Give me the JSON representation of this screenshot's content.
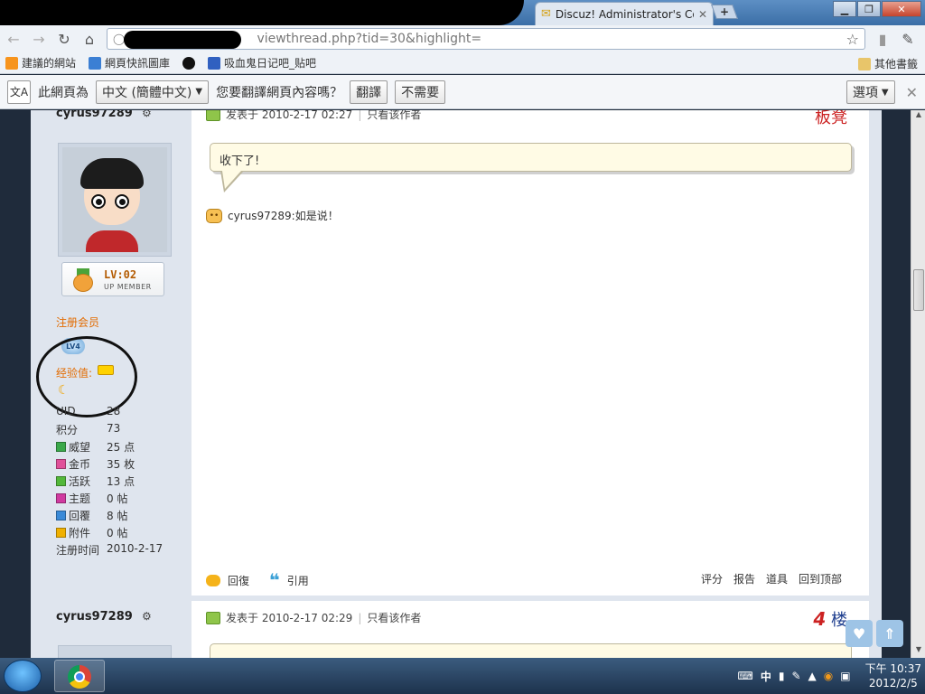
{
  "browser": {
    "tab_title": "Discuz! Administrator's Co",
    "url": "viewthread.php?tid=30&highlight=",
    "bookmarks": [
      {
        "label": "建議的網站",
        "color": "#f7941d"
      },
      {
        "label": "網頁快訊圖庫",
        "color": "#3b7fd4"
      },
      {
        "label": "",
        "color": "#c92a2a"
      },
      {
        "label": "吸血鬼日记吧_贴吧",
        "color": "#3060c0"
      }
    ],
    "bookmarks_other": "其他書籤",
    "translate": {
      "prompt_prefix": "此網頁為",
      "language": "中文 (簡體中文)",
      "question": "您要翻譯網頁內容嗎？",
      "translate_btn": "翻譯",
      "no_btn": "不需要",
      "options_btn": "選項"
    }
  },
  "user": {
    "name": "cyrus97289",
    "badge_level": "LV:02",
    "badge_sub": "UP MEMBER",
    "group": "注册会员",
    "level_icon": "LV4",
    "exp_label": "经验值:",
    "stats": [
      {
        "key": "UID",
        "value": "28",
        "icon_color": ""
      },
      {
        "key": "积分",
        "value": "73",
        "icon_color": ""
      },
      {
        "key": "威望",
        "value": "25 点",
        "icon_color": "#3aa84a"
      },
      {
        "key": "金币",
        "value": "35 枚",
        "icon_color": "#e0509a"
      },
      {
        "key": "活跃",
        "value": "13 点",
        "icon_color": "#53b83a"
      },
      {
        "key": "主题",
        "value": "0 帖",
        "icon_color": "#d03aa0"
      },
      {
        "key": "回覆",
        "value": "8 帖",
        "icon_color": "#3a8ad8"
      },
      {
        "key": "附件",
        "value": "0 帖",
        "icon_color": "#f0b000"
      },
      {
        "key": "注册时间",
        "value": "2010-2-17",
        "icon_color": ""
      }
    ]
  },
  "post1": {
    "posted_label": "发表于 2010-2-17 02:27",
    "only_author": "只看该作者",
    "floor": "板凳",
    "message": "收下了!",
    "signature": "cyrus97289:如是说！",
    "actions": {
      "reply": "回復",
      "quote": "引用"
    },
    "actions_right": [
      "评分",
      "报告",
      "道具",
      "回到顶部"
    ]
  },
  "post2": {
    "username": "cyrus97289",
    "posted_label": "发表于 2010-2-17 02:29",
    "only_author": "只看该作者",
    "floor_num": "4",
    "floor_char": "楼"
  },
  "taskbar": {
    "ime": "中",
    "time": "下午 10:37",
    "date": "2012/2/5"
  }
}
